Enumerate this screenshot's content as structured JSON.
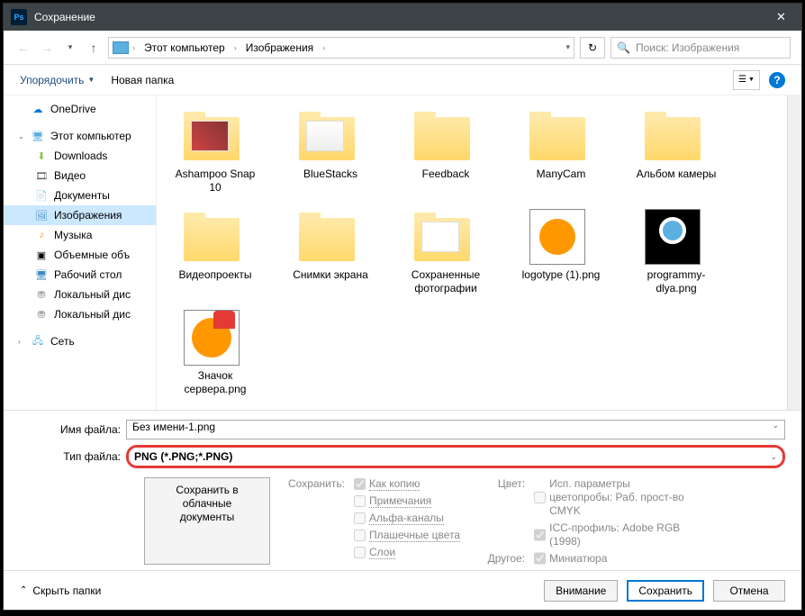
{
  "title": "Сохранение",
  "breadcrumb": {
    "root": "Этот компьютер",
    "folder": "Изображения"
  },
  "search": {
    "placeholder": "Поиск: Изображения"
  },
  "toolbar": {
    "organize": "Упорядочить",
    "newfolder": "Новая папка"
  },
  "sidebar": {
    "onedrive": "OneDrive",
    "pc": "Этот компьютер",
    "downloads": "Downloads",
    "video": "Видео",
    "documents": "Документы",
    "images": "Изображения",
    "music": "Музыка",
    "volumes": "Объемные объ",
    "desktop": "Рабочий стол",
    "disk1": "Локальный дис",
    "disk2": "Локальный дис",
    "network": "Сеть"
  },
  "items": [
    {
      "label": "Ashampoo Snap 10",
      "type": "folder"
    },
    {
      "label": "BlueStacks",
      "type": "folder"
    },
    {
      "label": "Feedback",
      "type": "folder"
    },
    {
      "label": "ManyCam",
      "type": "folder"
    },
    {
      "label": "Альбом камеры",
      "type": "folder"
    },
    {
      "label": "Видеопроекты",
      "type": "folder"
    },
    {
      "label": "Снимки экрана",
      "type": "folder"
    },
    {
      "label": "Сохраненные фотографии",
      "type": "folder"
    },
    {
      "label": "logotype (1).png",
      "type": "image"
    },
    {
      "label": "programmy-dlya.png",
      "type": "image"
    },
    {
      "label": "Значок сервера.png",
      "type": "image"
    }
  ],
  "filename": {
    "label": "Имя файла:",
    "value": "Без имени-1.png"
  },
  "filetype": {
    "label": "Тип файла:",
    "value": "PNG (*.PNG;*.PNG)"
  },
  "cloud": "Сохранить в облачные документы",
  "opts": {
    "save_head": "Сохранить:",
    "as_copy": "Как копию",
    "notes": "Примечания",
    "alpha": "Альфа-каналы",
    "spot": "Плашечные цвета",
    "layers": "Слои",
    "color_head": "Цвет:",
    "proof": "Исп. параметры цветопробы: Раб. прост-во CMYK",
    "icc": "ICC-профиль: Adobe RGB (1998)",
    "other_head": "Другое:",
    "thumb": "Миниатюра"
  },
  "footer": {
    "hide": "Скрыть папки",
    "attention": "Внимание",
    "save": "Сохранить",
    "cancel": "Отмена"
  }
}
